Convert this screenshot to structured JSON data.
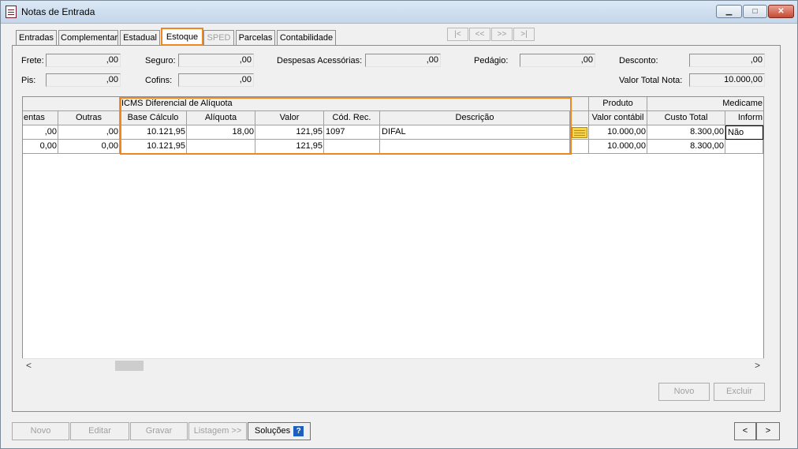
{
  "window": {
    "title": "Notas de Entrada",
    "min_label": "▁",
    "max_label": "□",
    "close_label": "✕"
  },
  "tabs": [
    {
      "label": "Entradas"
    },
    {
      "label": "Complementar"
    },
    {
      "label": "Estadual"
    },
    {
      "label": "Estoque"
    },
    {
      "label": "SPED"
    },
    {
      "label": "Parcelas"
    },
    {
      "label": "Contabilidade"
    }
  ],
  "nav": {
    "first": "|<",
    "prev": "<<",
    "next": ">>",
    "last": ">|"
  },
  "fields": {
    "frete": {
      "label": "Frete:",
      "value": ",00"
    },
    "seguro": {
      "label": "Seguro:",
      "value": ",00"
    },
    "despesas": {
      "label": "Despesas Acessórias:",
      "value": ",00"
    },
    "pedagio": {
      "label": "Pedágio:",
      "value": ",00"
    },
    "desconto": {
      "label": "Desconto:",
      "value": ",00"
    },
    "pis": {
      "label": "Pis:",
      "value": ",00"
    },
    "cofins": {
      "label": "Cofins:",
      "value": ",00"
    },
    "valor_total_nota": {
      "label": "Valor Total Nota:",
      "value": "10.000,00"
    }
  },
  "grid": {
    "group_headers": {
      "icms_dif": "ICMS Diferencial de Alíquota",
      "produto": "Produto",
      "medicamento": "Medicame"
    },
    "columns": {
      "isentas": "entas",
      "outras": "Outras",
      "base_calculo": "Base Cálculo",
      "aliquota": "Alíquota",
      "valor": "Valor",
      "cod_rec": "Cód. Rec.",
      "descricao": "Descrição",
      "valor_contabil": "Valor contábil",
      "custo_total": "Custo Total",
      "inform": "Inform"
    },
    "rows": [
      {
        "isentas": ",00",
        "outras": ",00",
        "base_calculo": "10.121,95",
        "aliquota": "18,00",
        "valor": "121,95",
        "cod_rec": "1097",
        "descricao": "DIFAL",
        "valor_contabil": "10.000,00",
        "custo_total": "8.300,00",
        "inform": "Não"
      },
      {
        "isentas": "0,00",
        "outras": "0,00",
        "base_calculo": "10.121,95",
        "aliquota": "",
        "valor": "121,95",
        "cod_rec": "",
        "descricao": "",
        "valor_contabil": "10.000,00",
        "custo_total": "8.300,00",
        "inform": ""
      }
    ]
  },
  "scroll": {
    "left": "<",
    "right": ">"
  },
  "inner_buttons": {
    "novo": "Novo",
    "excluir": "Excluir"
  },
  "bottom_buttons": {
    "novo": "Novo",
    "editar": "Editar",
    "gravar": "Gravar",
    "listagem": "Listagem >>",
    "solucoes": "Soluções",
    "help": "?",
    "prev": "<",
    "next": ">"
  },
  "colors": {
    "highlight": "#f0861e"
  }
}
